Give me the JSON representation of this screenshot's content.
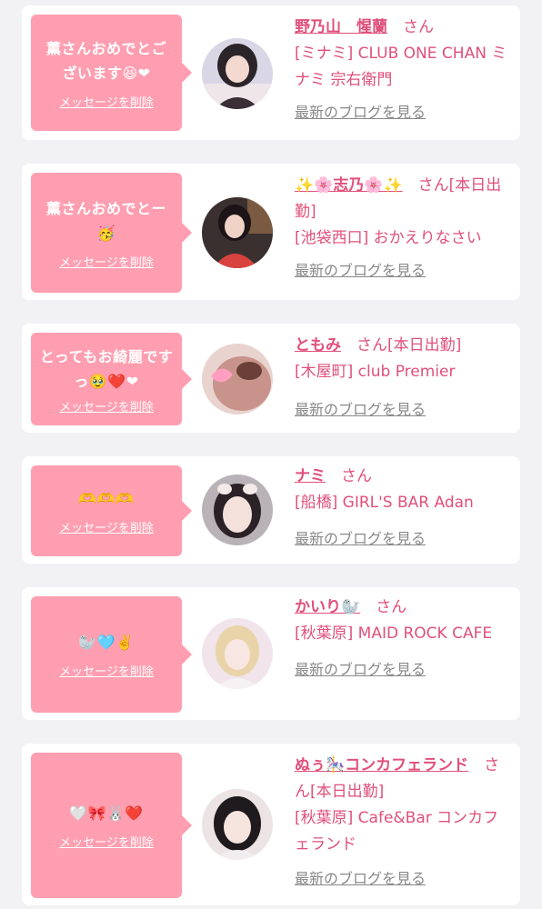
{
  "messages": [
    {
      "text": "薫さんおめでとございます😆❤",
      "delete_label": "メッセージを削除",
      "name": "野乃山　惺蘭",
      "status": "さん",
      "shop": "[ミナミ] CLUB ONE CHAN ミナミ 宗右衛門",
      "blog_label": "最新のブログを見る"
    },
    {
      "text": "薫さんおめでとー🥳",
      "delete_label": "メッセージを削除",
      "name": "✨🌸志乃🌸✨",
      "status": "さん[本日出勤]",
      "shop": "[池袋西口] おかえりなさい",
      "blog_label": "最新のブログを見る"
    },
    {
      "text": "とってもお綺麗ですっ🥹❤️❤",
      "delete_label": "メッセージを削除",
      "name": "ともみ",
      "status": "さん[本日出勤]",
      "shop": "[木屋町] club Premier",
      "blog_label": "最新のブログを見る"
    },
    {
      "text": "🫶🫶🫶",
      "delete_label": "メッセージを削除",
      "name": "ナミ",
      "status": "さん",
      "shop": "[船橋] GIRL'S BAR Adan",
      "blog_label": "最新のブログを見る"
    },
    {
      "text": "🦭🩵✌️",
      "delete_label": "メッセージを削除",
      "name": "かいり🦭",
      "status": "さん",
      "shop": "[秋葉原] MAID ROCK CAFE",
      "blog_label": "最新のブログを見る"
    },
    {
      "text": "🤍🎀🐰❤️",
      "delete_label": "メッセージを削除",
      "name": "ぬぅ🎠コンカフェランド",
      "status": "さん[本日出勤]",
      "shop": "[秋葉原] Cafe&Bar コンカフェランド",
      "blog_label": "最新のブログを見る"
    }
  ],
  "colors": {
    "accent": "#e0507a",
    "bubble": "#ff9eb0",
    "muted": "#888888",
    "background": "#f2f2f4"
  }
}
